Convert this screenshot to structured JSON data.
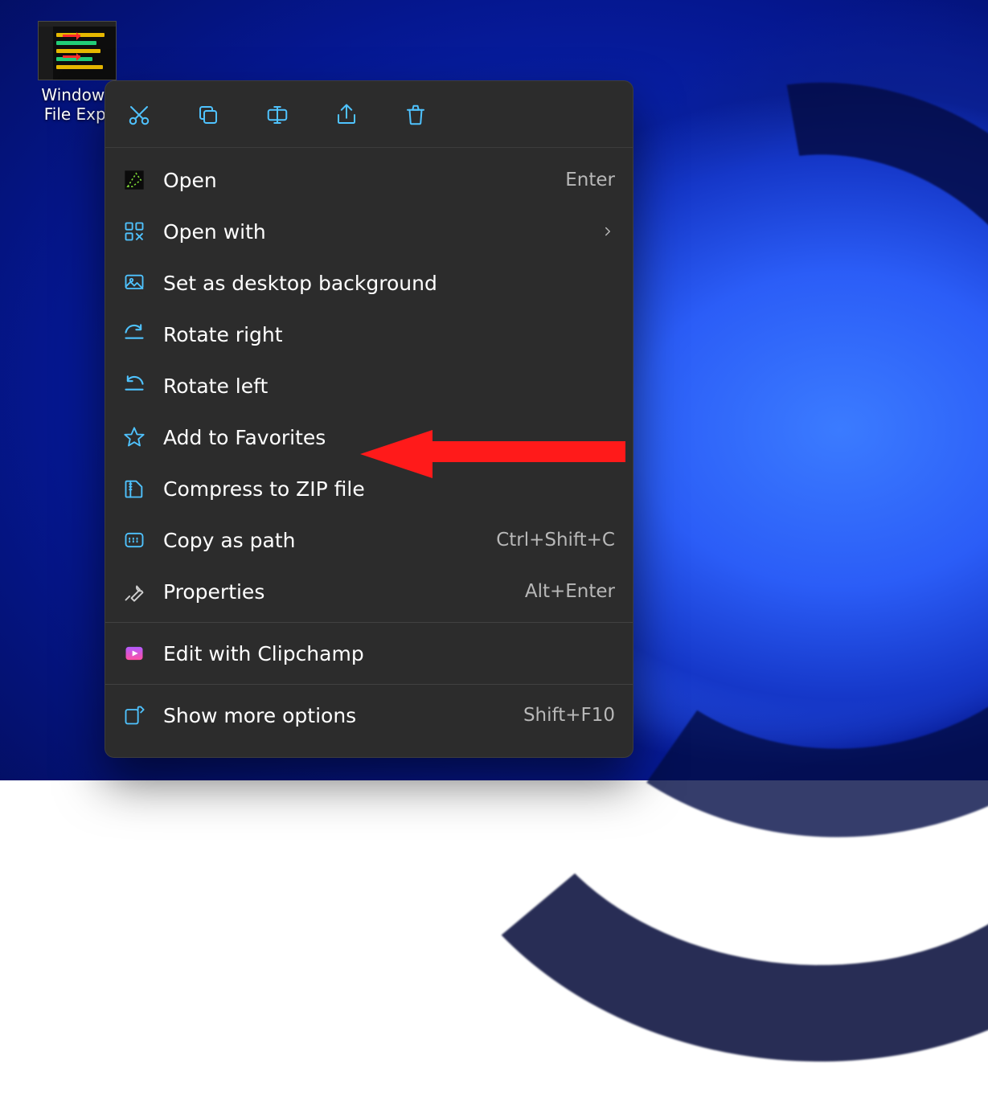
{
  "desktop_icon": {
    "label_line1": "Windows",
    "label_line2": "File Expl"
  },
  "action_bar": [
    {
      "name": "cut"
    },
    {
      "name": "copy"
    },
    {
      "name": "rename"
    },
    {
      "name": "share"
    },
    {
      "name": "delete"
    }
  ],
  "menu": {
    "group1": [
      {
        "id": "open",
        "label": "Open",
        "shortcut": "Enter",
        "submenu": false
      },
      {
        "id": "open-with",
        "label": "Open with",
        "shortcut": "",
        "submenu": true
      },
      {
        "id": "set-bg",
        "label": "Set as desktop background",
        "shortcut": "",
        "submenu": false
      },
      {
        "id": "rotate-r",
        "label": "Rotate right",
        "shortcut": "",
        "submenu": false
      },
      {
        "id": "rotate-l",
        "label": "Rotate left",
        "shortcut": "",
        "submenu": false
      },
      {
        "id": "fav",
        "label": "Add to Favorites",
        "shortcut": "",
        "submenu": false
      },
      {
        "id": "zip",
        "label": "Compress to ZIP file",
        "shortcut": "",
        "submenu": false
      },
      {
        "id": "copy-path",
        "label": "Copy as path",
        "shortcut": "Ctrl+Shift+C",
        "submenu": false
      },
      {
        "id": "properties",
        "label": "Properties",
        "shortcut": "Alt+Enter",
        "submenu": false
      }
    ],
    "group2": [
      {
        "id": "clipchamp",
        "label": "Edit with Clipchamp",
        "shortcut": "",
        "submenu": false
      }
    ],
    "group3": [
      {
        "id": "more",
        "label": "Show more options",
        "shortcut": "Shift+F10",
        "submenu": false
      }
    ]
  },
  "annotation": {
    "points_to": "fav"
  }
}
